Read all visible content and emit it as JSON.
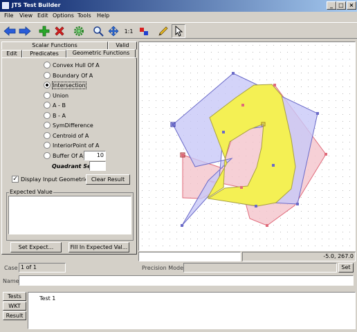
{
  "window": {
    "title": "JTS Test Builder",
    "buttons": [
      "_",
      "□",
      "×"
    ]
  },
  "menu": [
    "File",
    "View",
    "Edit",
    "Options",
    "Tools",
    "Help"
  ],
  "toolbar": {
    "icons": [
      "arrow-left-icon",
      "arrow-right-icon",
      "add-icon",
      "delete-icon",
      "gear-icon",
      "zoom-icon",
      "pan-icon",
      "one-to-one-icon",
      "color-icon",
      "pencil-icon",
      "pointer-icon"
    ],
    "scale_label": "1:1"
  },
  "tabs": {
    "row1": [
      "Scalar Functions",
      "Valid"
    ],
    "row2": [
      "Edit",
      "Predicates",
      "Geometric Functions"
    ],
    "active": "Geometric Functions"
  },
  "functions": {
    "options": [
      "Convex Hull Of A",
      "Boundary Of A",
      "Intersection",
      "Union",
      "A - B",
      "B - A",
      "SymDifference",
      "Centroid of A",
      "InteriorPoint of A",
      "Buffer Of A:"
    ],
    "selected": "Intersection",
    "buffer_value": "10",
    "quadrant_label": "Quadrant Segs",
    "quadrant_value": ""
  },
  "display_input": {
    "label": "Display Input Geometries",
    "checked": true
  },
  "clear_result_label": "Clear Result",
  "expected": {
    "group_label": "Expected Value",
    "value": "",
    "set_expected_label": "Set Expect...",
    "fill_expected_label": "Fill In Expected Val..."
  },
  "canvas": {
    "coords": "-5.0, 267.0",
    "colors": {
      "a_fill": "#c8c8f8",
      "a_stroke": "#6a6ac8",
      "b_fill": "#f4c4cc",
      "b_stroke": "#e06a7a",
      "result_fill": "#f4f054",
      "result_stroke": "#a8a040",
      "grid": "#d0d0d0"
    }
  },
  "case": {
    "label": "Case",
    "value": "1 of 1",
    "precision_label": "Precision Model",
    "precision_value": "",
    "set_label": "Set"
  },
  "name": {
    "label": "Name",
    "value": ""
  },
  "bottom_tabs": [
    "Tests",
    "WKT",
    "Result"
  ],
  "tests": [
    "Test 1"
  ]
}
